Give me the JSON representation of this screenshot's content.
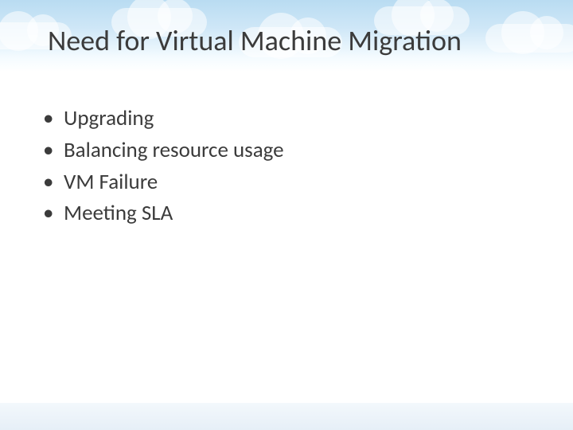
{
  "title": "Need for Virtual Machine Migration",
  "bullets": {
    "0": "Upgrading",
    "1": "Balancing resource usage",
    "2": "VM Failure",
    "3": "Meeting SLA"
  },
  "bullet_char": "•"
}
